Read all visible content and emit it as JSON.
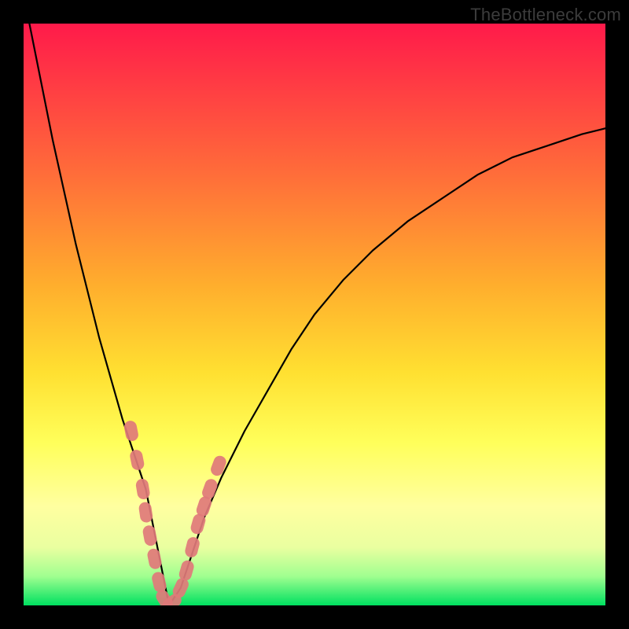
{
  "watermark": "TheBottleneck.com",
  "chart_data": {
    "type": "line",
    "title": "",
    "xlabel": "",
    "ylabel": "",
    "xlim": [
      0,
      100
    ],
    "ylim": [
      0,
      100
    ],
    "grid": false,
    "legend": false,
    "series": [
      {
        "name": "bottleneck-curve",
        "x": [
          1,
          3,
          5,
          7,
          9,
          11,
          13,
          15,
          17,
          19,
          21,
          22,
          23,
          24,
          25,
          27,
          29,
          31,
          34,
          38,
          42,
          46,
          50,
          55,
          60,
          66,
          72,
          78,
          84,
          90,
          96,
          100
        ],
        "y": [
          100,
          90,
          80,
          71,
          62,
          54,
          46,
          39,
          32,
          26,
          20,
          15,
          10,
          5,
          0,
          3,
          9,
          15,
          22,
          30,
          37,
          44,
          50,
          56,
          61,
          66,
          70,
          74,
          77,
          79,
          81,
          82
        ],
        "color": "#000000"
      }
    ],
    "markers": {
      "name": "highlight-dots",
      "color": "#e07a7a",
      "points": [
        {
          "x": 18.5,
          "y": 30
        },
        {
          "x": 19.5,
          "y": 25
        },
        {
          "x": 20.5,
          "y": 20
        },
        {
          "x": 21.0,
          "y": 16
        },
        {
          "x": 21.7,
          "y": 12
        },
        {
          "x": 22.5,
          "y": 8
        },
        {
          "x": 23.3,
          "y": 4
        },
        {
          "x": 24.2,
          "y": 1
        },
        {
          "x": 25.5,
          "y": 0.5
        },
        {
          "x": 27.0,
          "y": 3
        },
        {
          "x": 28.0,
          "y": 6
        },
        {
          "x": 29.0,
          "y": 10
        },
        {
          "x": 30.0,
          "y": 14
        },
        {
          "x": 31.0,
          "y": 17
        },
        {
          "x": 32.0,
          "y": 20
        },
        {
          "x": 33.5,
          "y": 24
        }
      ]
    },
    "background_gradient": {
      "top": "#ff1a4a",
      "mid": "#ffe031",
      "bottom": "#00e060"
    }
  }
}
